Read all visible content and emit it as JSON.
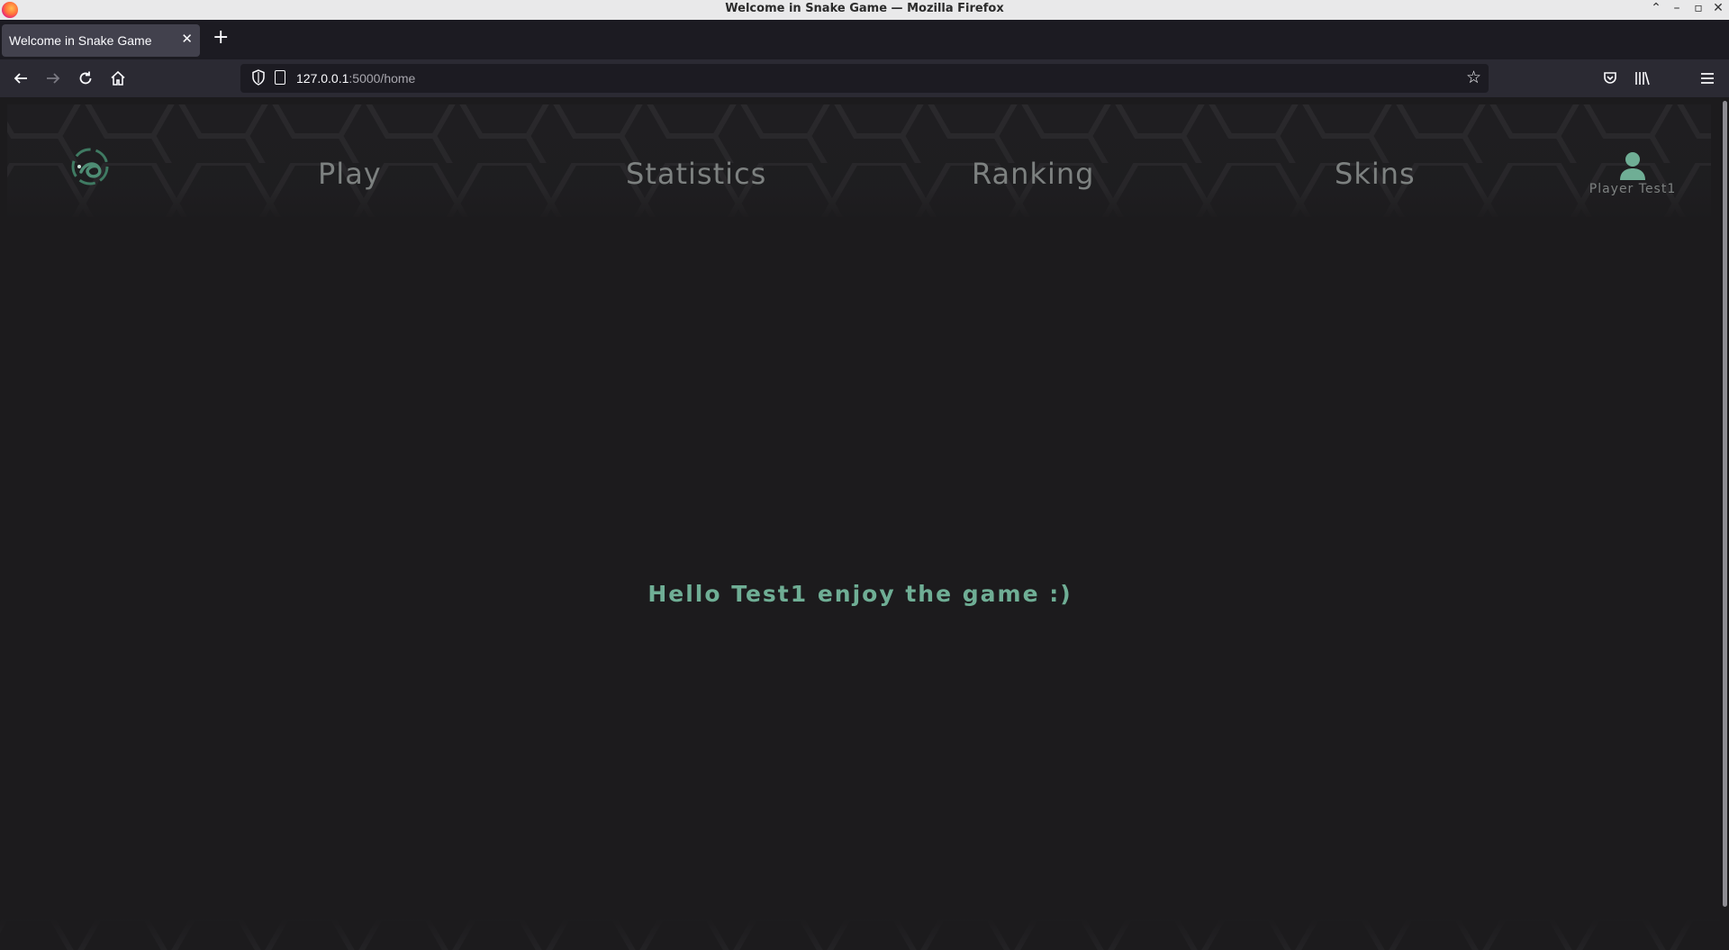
{
  "window": {
    "title": "Welcome in Snake Game — Mozilla Firefox"
  },
  "tabs": [
    {
      "title": "Welcome in Snake Game"
    }
  ],
  "urlbar": {
    "host": "127.0.0.1",
    "path": ":5000/home"
  },
  "site": {
    "nav": {
      "play": "Play",
      "statistics": "Statistics",
      "ranking": "Ranking",
      "skins": "Skins"
    },
    "user": {
      "name": "Player Test1"
    },
    "greeting": "Hello Test1 enjoy the game :)"
  },
  "colors": {
    "accent": "#6fae95",
    "nav_text": "#7d8180",
    "background": "#1c1b1d"
  },
  "icons": {
    "browser": [
      "back-icon",
      "forward-icon",
      "reload-icon",
      "home-icon",
      "shield-icon",
      "page-icon",
      "bookmark-star-icon",
      "pocket-icon",
      "library-icon",
      "extension-icon",
      "menu-icon"
    ],
    "site": [
      "snake-logo-icon",
      "user-icon"
    ]
  }
}
